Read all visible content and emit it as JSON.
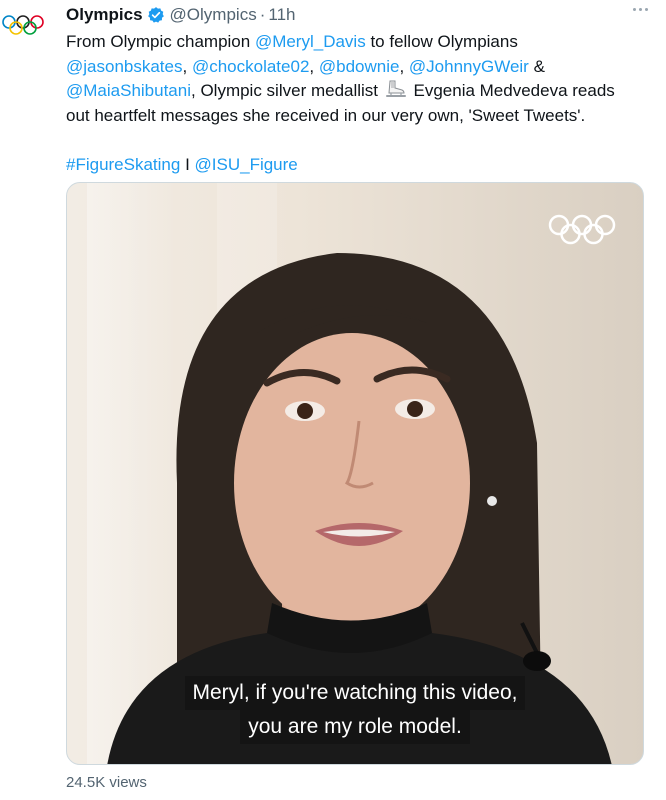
{
  "tweet": {
    "author_name": "Olympics",
    "handle": "@Olympics",
    "separator": "·",
    "time": "11h",
    "lines": [
      [
        {
          "t": "From Olympic champion ",
          "link": false
        },
        {
          "t": "@Meryl_Davis",
          "link": true
        },
        {
          "t": " to fellow Olympians",
          "link": false
        }
      ],
      [
        {
          "t": "@jasonbskates",
          "link": true
        },
        {
          "t": ", ",
          "link": false
        },
        {
          "t": "@chockolate02",
          "link": true
        },
        {
          "t": ", ",
          "link": false
        },
        {
          "t": "@bdownie",
          "link": true
        },
        {
          "t": ", ",
          "link": false
        },
        {
          "t": "@JohnnyGWeir",
          "link": true
        },
        {
          "t": " &",
          "link": false
        }
      ],
      [
        {
          "t": "@MaiaShibutani",
          "link": true
        },
        {
          "t": ", Olympic silver medallist ",
          "link": false
        },
        {
          "emoji": "ice-skate"
        },
        {
          "t": " Evgenia Medvedeva reads",
          "link": false
        }
      ],
      [
        {
          "t": "out heartfelt messages she received in our very own, 'Sweet Tweets'.",
          "link": false
        }
      ],
      [],
      [
        {
          "t": "#FigureSkating",
          "link": true
        },
        {
          "t": " I ",
          "link": false
        },
        {
          "t": "@ISU_Figure",
          "link": true
        }
      ]
    ],
    "video": {
      "caption_line1": "Meryl, if you're watching this video,",
      "caption_line2": "you are my role model."
    },
    "views": "24.5K views"
  },
  "colors": {
    "link": "#1d9bf0",
    "text": "#0f1419",
    "muted": "#536471",
    "verified": "#1d9bf0"
  },
  "icons": [
    "olympic-rings-icon",
    "verified-badge-icon",
    "more-options-icon",
    "ice-skate-icon"
  ]
}
